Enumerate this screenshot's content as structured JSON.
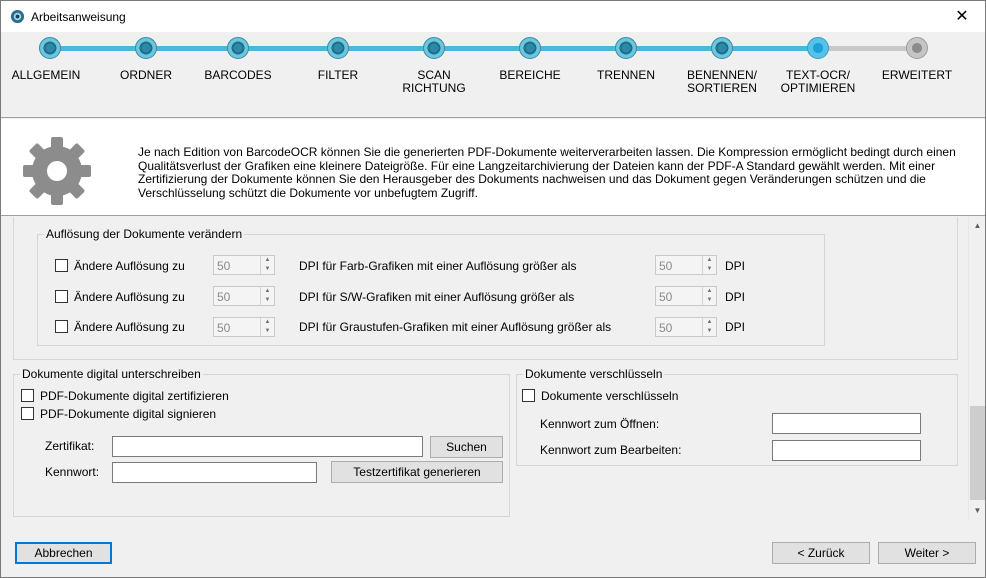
{
  "window": {
    "title": "Arbeitsanweisung",
    "close_glyph": "✕"
  },
  "wizard": {
    "steps": [
      {
        "label": "ALLGEMEIN",
        "state": "done"
      },
      {
        "label": "ORDNER",
        "state": "done"
      },
      {
        "label": "BARCODES",
        "state": "done"
      },
      {
        "label": "FILTER",
        "state": "done"
      },
      {
        "label": "SCAN\nRICHTUNG",
        "state": "done"
      },
      {
        "label": "BEREICHE",
        "state": "done"
      },
      {
        "label": "TRENNEN",
        "state": "done"
      },
      {
        "label": "BENENNEN/\nSORTIEREN",
        "state": "done"
      },
      {
        "label": "TEXT-OCR/\nOPTIMIEREN",
        "state": "current"
      },
      {
        "label": "ERWEITERT",
        "state": "todo"
      }
    ]
  },
  "info": {
    "icon": "gear-icon",
    "text": "Je nach Edition von BarcodeOCR können Sie die generierten PDF-Dokumente weiterverarbeiten lassen. Die Kompression ermöglicht bedingt durch einen Qualitätsverlust der Grafiken eine kleinere Dateigröße. Für eine Langzeitarchivierung der Dateien kann der PDF-A Standard gewählt werden. Mit einer Zertifizierung der Dokumente können Sie den Herausgeber des Dokuments nachweisen und das Dokument gegen Veränderungen schützen und die Verschlüsselung schützt die Dokumente vor unbefugtem Zugriff."
  },
  "resolution": {
    "legend": "Auflösung der Dokumente verändern",
    "rows": [
      {
        "checkbox_label": "Ändere Auflösung zu",
        "dpi_value": "50",
        "description": "DPI für Farb-Grafiken mit einer Auflösung größer als",
        "threshold_value": "50",
        "unit": "DPI"
      },
      {
        "checkbox_label": "Ändere Auflösung zu",
        "dpi_value": "50",
        "description": "DPI für S/W-Grafiken mit einer Auflösung größer als",
        "threshold_value": "50",
        "unit": "DPI"
      },
      {
        "checkbox_label": "Ändere Auflösung zu",
        "dpi_value": "50",
        "description": "DPI für Graustufen-Grafiken mit einer Auflösung größer als",
        "threshold_value": "50",
        "unit": "DPI"
      }
    ]
  },
  "signing": {
    "legend": "Dokumente digital unterschreiben",
    "certify_label": "PDF-Dokumente digital zertifizieren",
    "sign_label": "PDF-Dokumente digital signieren",
    "certificate_label": "Zertifikat:",
    "certificate_value": "",
    "browse_button": "Suchen",
    "password_label": "Kennwort:",
    "password_value": "",
    "generate_button": "Testzertifikat generieren"
  },
  "encryption": {
    "legend": "Dokumente verschlüsseln",
    "encrypt_label": "Dokumente verschlüsseln",
    "open_password_label": "Kennwort zum Öffnen:",
    "open_password_value": "",
    "edit_password_label": "Kennwort zum Bearbeiten:",
    "edit_password_value": ""
  },
  "footer": {
    "cancel_button": "Abbrechen",
    "back_button": "< Zurück",
    "next_button": "Weiter >"
  },
  "colors": {
    "accent": "#0078d7",
    "step_done": "#4fb5db",
    "step_todo": "#c8c8c8"
  }
}
